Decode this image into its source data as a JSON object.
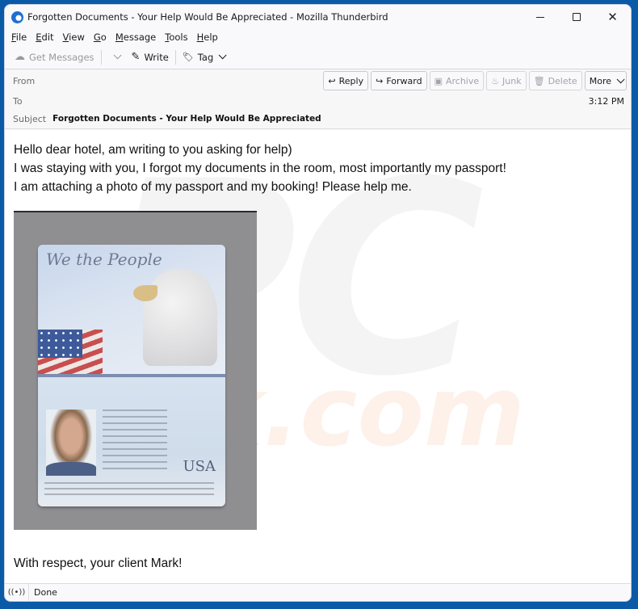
{
  "window": {
    "title": "Forgotten Documents - Your Help Would Be Appreciated - Mozilla Thunderbird",
    "controls": {
      "minimize": "minimize",
      "maximize": "maximize",
      "close": "✕"
    }
  },
  "menubar": {
    "items": [
      {
        "accel": "F",
        "rest": "ile"
      },
      {
        "accel": "E",
        "rest": "dit"
      },
      {
        "accel": "V",
        "rest": "iew"
      },
      {
        "accel": "G",
        "rest": "o"
      },
      {
        "accel": "M",
        "rest": "essage"
      },
      {
        "accel": "T",
        "rest": "ools"
      },
      {
        "accel": "H",
        "rest": "elp"
      }
    ]
  },
  "toolbar": {
    "get_messages": {
      "label": "Get Messages",
      "icon": "☁",
      "enabled": false
    },
    "write": {
      "label": "Write",
      "icon": "✎"
    },
    "tag": {
      "label": "Tag",
      "icon": "🏷"
    }
  },
  "header": {
    "from_label": "From",
    "to_label": "To",
    "subject_label": "Subject",
    "subject_value": "Forgotten Documents - Your Help Would Be Appreciated",
    "time": "3:12 PM",
    "actions": [
      {
        "label": "Reply",
        "icon": "↩",
        "enabled": true
      },
      {
        "label": "Forward",
        "icon": "↪",
        "enabled": true
      },
      {
        "label": "Archive",
        "icon": "▣",
        "enabled": false
      },
      {
        "label": "Junk",
        "icon": "♨",
        "enabled": false
      },
      {
        "label": "Delete",
        "icon": "🗑",
        "enabled": false
      },
      {
        "label": "More",
        "icon": "",
        "enabled": true
      }
    ]
  },
  "message": {
    "lines": [
      "Hello dear hotel,  am writing to you asking for help)",
      "I was staying with you, I forgot my documents in the room, most importantly my passport!",
      "I am attaching a photo of my passport and my booking! Please help me."
    ],
    "attachment_image": {
      "description": "photo of a US passport",
      "title_text": "We the People",
      "country": "USA"
    },
    "signoff": "With respect, your client Mark!"
  },
  "watermark": {
    "text1": "PC",
    "text2": "k.com"
  },
  "statusbar": {
    "icon": "((•))",
    "text": "Done"
  }
}
